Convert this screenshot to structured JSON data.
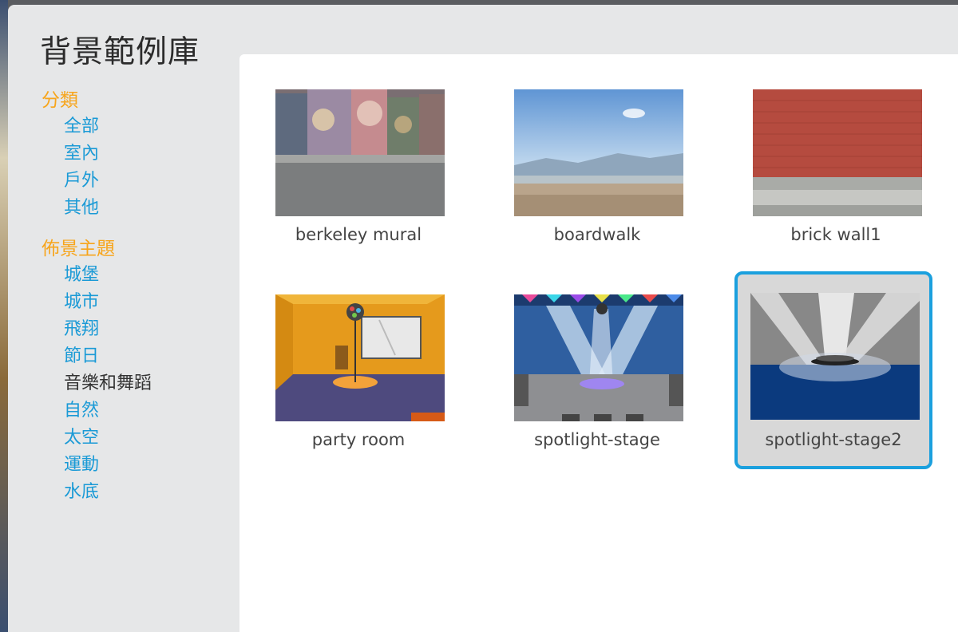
{
  "dialog": {
    "title": "背景範例庫"
  },
  "sidebar": {
    "category_title": "分類",
    "categories": [
      "全部",
      "室內",
      "戶外",
      "其他"
    ],
    "theme_title": "佈景主題",
    "themes": [
      "城堡",
      "城市",
      "飛翔",
      "節日",
      "音樂和舞蹈",
      "自然",
      "太空",
      "運動",
      "水底"
    ]
  },
  "backdrops": [
    {
      "name": "berkeley mural"
    },
    {
      "name": "boardwalk"
    },
    {
      "name": "brick wall1"
    },
    {
      "name": "party room"
    },
    {
      "name": "spotlight-stage"
    },
    {
      "name": "spotlight-stage2",
      "selected": true
    }
  ],
  "colors": {
    "accent_orange": "#f7a51c",
    "link_blue": "#1a9ad6",
    "selection_blue": "#1ba0de"
  }
}
